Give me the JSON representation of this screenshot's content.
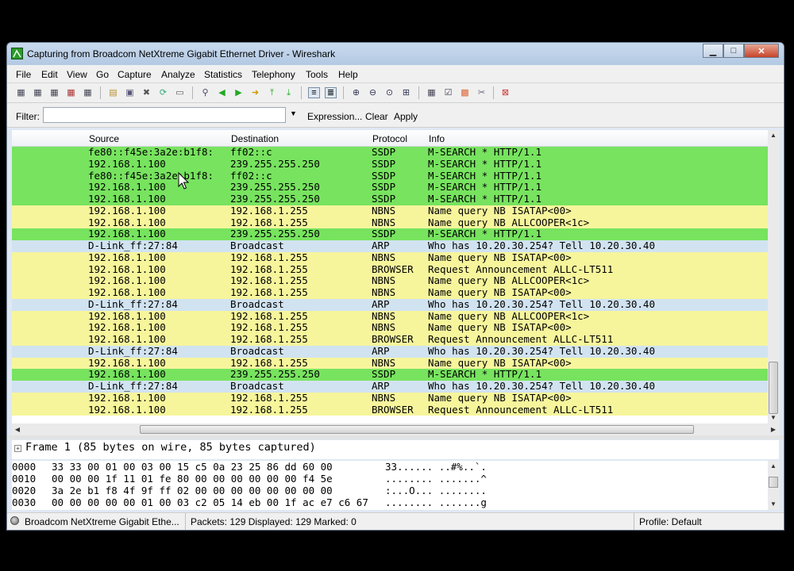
{
  "window": {
    "title": "Capturing from Broadcom NetXtreme Gigabit Ethernet Driver - Wireshark",
    "controls": [
      "minimize",
      "maximize",
      "close"
    ]
  },
  "menu": [
    "File",
    "Edit",
    "View",
    "Go",
    "Capture",
    "Analyze",
    "Statistics",
    "Telephony",
    "Tools",
    "Help"
  ],
  "toolbar_icons": [
    "interfaces-icon",
    "options-icon",
    "start-icon",
    "stop-icon",
    "restart-icon",
    "open-icon",
    "save-icon",
    "close-file-icon",
    "reload-icon",
    "print-icon",
    "find-icon",
    "back-icon",
    "forward-icon",
    "go-to-icon",
    "first-icon",
    "last-icon",
    "colorize-icon",
    "autoscroll-icon",
    "zoom-in-icon",
    "zoom-out-icon",
    "normal-size-icon",
    "resize-columns-icon",
    "capture-filters-icon",
    "display-filters-icon",
    "coloring-rules-icon",
    "preferences-icon",
    "help-icon"
  ],
  "filter": {
    "label": "Filter:",
    "value": "",
    "expression": "Expression...",
    "clear": "Clear",
    "apply": "Apply"
  },
  "columns": {
    "source": "Source",
    "destination": "Destination",
    "protocol": "Protocol",
    "info": "Info"
  },
  "colors": {
    "green": "#77e35f",
    "yellow": "#f6f59c",
    "blue": "#d1e3f1"
  },
  "packets": [
    {
      "source": "fe80::f45e:3a2e:b1f8:",
      "destination": "ff02::c",
      "protocol": "SSDP",
      "info": "M-SEARCH * HTTP/1.1",
      "color": "green"
    },
    {
      "source": "192.168.1.100",
      "destination": "239.255.255.250",
      "protocol": "SSDP",
      "info": "M-SEARCH * HTTP/1.1",
      "color": "green"
    },
    {
      "source": "fe80::f45e:3a2e:b1f8:",
      "destination": "ff02::c",
      "protocol": "SSDP",
      "info": "M-SEARCH * HTTP/1.1",
      "color": "green"
    },
    {
      "source": "192.168.1.100",
      "destination": "239.255.255.250",
      "protocol": "SSDP",
      "info": "M-SEARCH * HTTP/1.1",
      "color": "green"
    },
    {
      "source": "192.168.1.100",
      "destination": "239.255.255.250",
      "protocol": "SSDP",
      "info": "M-SEARCH * HTTP/1.1",
      "color": "green"
    },
    {
      "source": "192.168.1.100",
      "destination": "192.168.1.255",
      "protocol": "NBNS",
      "info": "Name query NB ISATAP<00>",
      "color": "yellow"
    },
    {
      "source": "192.168.1.100",
      "destination": "192.168.1.255",
      "protocol": "NBNS",
      "info": "Name query NB ALLCOOPER<1c>",
      "color": "yellow"
    },
    {
      "source": "192.168.1.100",
      "destination": "239.255.255.250",
      "protocol": "SSDP",
      "info": "M-SEARCH * HTTP/1.1",
      "color": "green"
    },
    {
      "source": "D-Link_ff:27:84",
      "destination": "Broadcast",
      "protocol": "ARP",
      "info": "Who has 10.20.30.254?  Tell 10.20.30.40",
      "color": "blue"
    },
    {
      "source": "192.168.1.100",
      "destination": "192.168.1.255",
      "protocol": "NBNS",
      "info": "Name query NB ISATAP<00>",
      "color": "yellow"
    },
    {
      "source": "192.168.1.100",
      "destination": "192.168.1.255",
      "protocol": "BROWSER",
      "info": "Request Announcement ALLC-LT511",
      "color": "yellow"
    },
    {
      "source": "192.168.1.100",
      "destination": "192.168.1.255",
      "protocol": "NBNS",
      "info": "Name query NB ALLCOOPER<1c>",
      "color": "yellow"
    },
    {
      "source": "192.168.1.100",
      "destination": "192.168.1.255",
      "protocol": "NBNS",
      "info": "Name query NB ISATAP<00>",
      "color": "yellow"
    },
    {
      "source": "D-Link_ff:27:84",
      "destination": "Broadcast",
      "protocol": "ARP",
      "info": "Who has 10.20.30.254?  Tell 10.20.30.40",
      "color": "blue"
    },
    {
      "source": "192.168.1.100",
      "destination": "192.168.1.255",
      "protocol": "NBNS",
      "info": "Name query NB ALLCOOPER<1c>",
      "color": "yellow"
    },
    {
      "source": "192.168.1.100",
      "destination": "192.168.1.255",
      "protocol": "NBNS",
      "info": "Name query NB ISATAP<00>",
      "color": "yellow"
    },
    {
      "source": "192.168.1.100",
      "destination": "192.168.1.255",
      "protocol": "BROWSER",
      "info": "Request Announcement ALLC-LT511",
      "color": "yellow"
    },
    {
      "source": "D-Link_ff:27:84",
      "destination": "Broadcast",
      "protocol": "ARP",
      "info": "Who has 10.20.30.254?  Tell 10.20.30.40",
      "color": "blue"
    },
    {
      "source": "192.168.1.100",
      "destination": "192.168.1.255",
      "protocol": "NBNS",
      "info": "Name query NB ISATAP<00>",
      "color": "yellow"
    },
    {
      "source": "192.168.1.100",
      "destination": "239.255.255.250",
      "protocol": "SSDP",
      "info": "M-SEARCH * HTTP/1.1",
      "color": "green"
    },
    {
      "source": "D-Link_ff:27:84",
      "destination": "Broadcast",
      "protocol": "ARP",
      "info": "Who has 10.20.30.254?  Tell 10.20.30.40",
      "color": "blue"
    },
    {
      "source": "192.168.1.100",
      "destination": "192.168.1.255",
      "protocol": "NBNS",
      "info": "Name query NB ISATAP<00>",
      "color": "yellow"
    },
    {
      "source": "192.168.1.100",
      "destination": "192.168.1.255",
      "protocol": "BROWSER",
      "info": "Request Announcement ALLC-LT511",
      "color": "yellow"
    }
  ],
  "details": {
    "frame": "Frame 1 (85 bytes on wire, 85 bytes captured)"
  },
  "bytes": [
    {
      "offset": "0000",
      "hex": "33 33 00 01 00 03 00 15  c5 0a 23 25 86 dd 60 00",
      "ascii": "33...... ..#%..`."
    },
    {
      "offset": "0010",
      "hex": "00 00 00 1f 11 01 fe 80  00 00 00 00 00 00 f4 5e",
      "ascii": "........ .......^"
    },
    {
      "offset": "0020",
      "hex": "3a 2e b1 f8 4f 9f ff 02  00 00 00 00 00 00 00 00",
      "ascii": ":...O... ........"
    },
    {
      "offset": "0030",
      "hex": "00 00 00 00 00 01 00 03 c2 05  14 eb 00 1f ac e7 c6 67",
      "ascii": "........ .......g"
    }
  ],
  "status": {
    "interface": "Broadcom NetXtreme Gigabit Ethe...",
    "packets": "Packets: 129 Displayed: 129 Marked: 0",
    "profile": "Profile: Default"
  }
}
